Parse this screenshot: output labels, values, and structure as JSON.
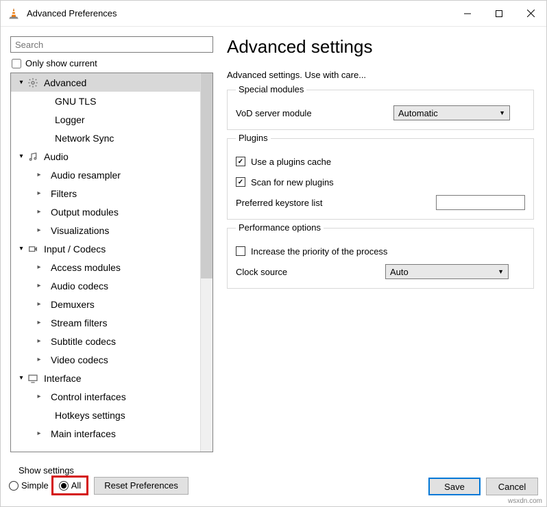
{
  "window": {
    "title": "Advanced Preferences"
  },
  "left": {
    "search_placeholder": "Search",
    "only_current": "Only show current",
    "tree": {
      "advanced": "Advanced",
      "gnu_tls": "GNU TLS",
      "logger": "Logger",
      "network_sync": "Network Sync",
      "audio": "Audio",
      "audio_resampler": "Audio resampler",
      "filters": "Filters",
      "output_modules": "Output modules",
      "visualizations": "Visualizations",
      "input_codecs": "Input / Codecs",
      "access_modules": "Access modules",
      "audio_codecs": "Audio codecs",
      "demuxers": "Demuxers",
      "stream_filters": "Stream filters",
      "subtitle_codecs": "Subtitle codecs",
      "video_codecs": "Video codecs",
      "interface": "Interface",
      "control_interfaces": "Control interfaces",
      "hotkeys_settings": "Hotkeys settings",
      "main_interfaces": "Main interfaces"
    }
  },
  "right": {
    "heading": "Advanced settings",
    "desc": "Advanced settings. Use with care...",
    "special_modules": {
      "legend": "Special modules",
      "vod_label": "VoD server module",
      "vod_value": "Automatic"
    },
    "plugins": {
      "legend": "Plugins",
      "use_cache": "Use a plugins cache",
      "scan_new": "Scan for new plugins",
      "keystore": "Preferred keystore list"
    },
    "perf": {
      "legend": "Performance options",
      "priority": "Increase the priority of the process",
      "clock_label": "Clock source",
      "clock_value": "Auto"
    }
  },
  "bottom": {
    "show_settings": "Show settings",
    "simple": "Simple",
    "all": "All",
    "reset": "Reset Preferences",
    "save": "Save",
    "cancel": "Cancel"
  },
  "watermark": "wsxdn.com"
}
